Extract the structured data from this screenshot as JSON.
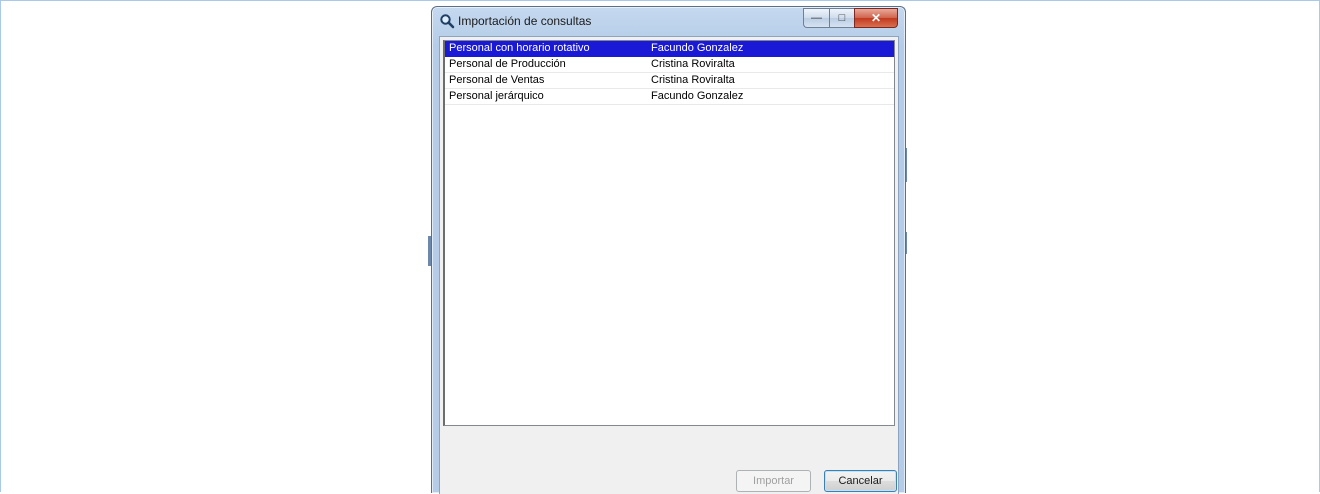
{
  "window": {
    "title": "Importación de consultas",
    "title_icon": "search-icon",
    "controls": {
      "minimize": "—",
      "maximize": "□",
      "close": "✕"
    }
  },
  "list": {
    "rows": [
      {
        "name": "Personal con horario rotativo",
        "owner": "Facundo Gonzalez",
        "selected": true
      },
      {
        "name": "Personal de Producción",
        "owner": "Cristina Roviralta",
        "selected": false
      },
      {
        "name": "Personal de Ventas",
        "owner": "Cristina Roviralta",
        "selected": false
      },
      {
        "name": "Personal jerárquico",
        "owner": "Facundo Gonzalez",
        "selected": false
      }
    ]
  },
  "buttons": {
    "import_label": "Importar",
    "cancel_label": "Cancelar"
  },
  "colors": {
    "selection": "#1a1ad6",
    "title_bar": "#b4cce8",
    "close_button": "#c2391f"
  }
}
